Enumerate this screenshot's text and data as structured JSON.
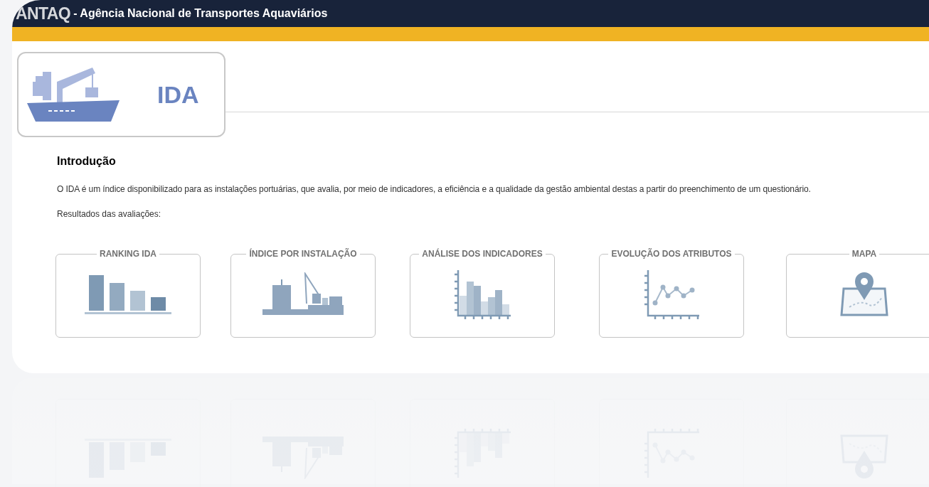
{
  "header": {
    "logo": "ANTAQ",
    "title": "- Agência Nacional de Transportes Aquaviários"
  },
  "banner": {
    "title": "IDA"
  },
  "intro": {
    "heading": "Introdução",
    "paragraph": "O IDA é um índice disponibilizado para as instalações portuárias, que avalia, por meio de indicadores, a eficiência e a qualidade da gestão ambiental destas a partir do preenchimento de um questionário.",
    "results_label": "Resultados das avaliações:"
  },
  "cards": [
    {
      "title": "RANKING IDA",
      "kind": "ranking"
    },
    {
      "title": "ÍNDICE POR INSTALAÇÃO",
      "kind": "port"
    },
    {
      "title": "ANÁLISE DOS INDICADORES",
      "kind": "histogram"
    },
    {
      "title": "EVOLUÇÃO DOS ATRIBUTOS",
      "kind": "line"
    },
    {
      "title": "MAPA",
      "kind": "map"
    }
  ]
}
